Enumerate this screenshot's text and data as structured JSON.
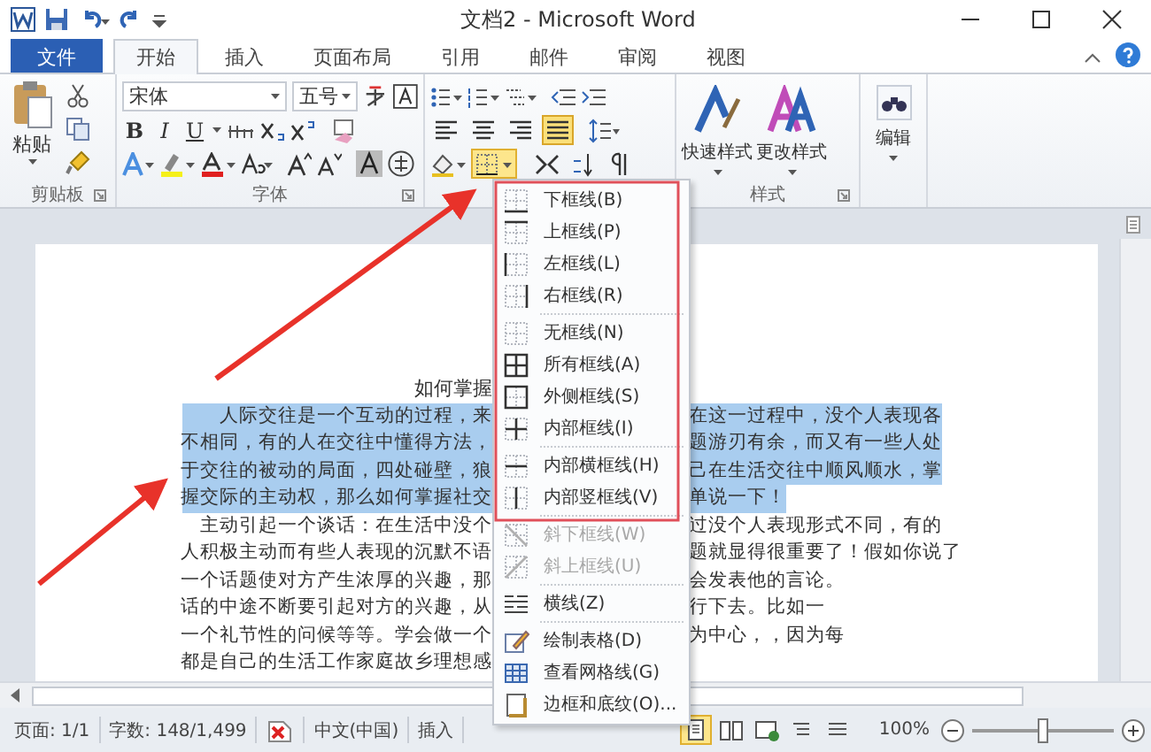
{
  "window": {
    "title": "文档2 - Microsoft Word"
  },
  "tabs": [
    {
      "label": "文件",
      "kind": "file",
      "selected": false
    },
    {
      "label": "开始",
      "kind": "tab",
      "selected": true
    },
    {
      "label": "插入",
      "kind": "tab",
      "selected": false
    },
    {
      "label": "页面布局",
      "kind": "tab",
      "selected": false
    },
    {
      "label": "引用",
      "kind": "tab",
      "selected": false
    },
    {
      "label": "邮件",
      "kind": "tab",
      "selected": false
    },
    {
      "label": "审阅",
      "kind": "tab",
      "selected": false
    },
    {
      "label": "视图",
      "kind": "tab",
      "selected": false
    }
  ],
  "ribbon": {
    "clipboard": {
      "paste": "粘贴",
      "label": "剪贴板"
    },
    "font": {
      "name": "宋体",
      "size": "五号",
      "format_buttons": [
        "B",
        "I",
        "U"
      ],
      "label": "字体"
    },
    "paragraph": {
      "align_buttons": [
        {
          "kind": "left",
          "selected": false
        },
        {
          "kind": "center",
          "selected": false
        },
        {
          "kind": "right",
          "selected": false
        },
        {
          "kind": "justify",
          "selected": true
        }
      ]
    },
    "styles": {
      "buttons": [
        "快速样式",
        "更改样式"
      ],
      "label": "样式"
    },
    "editing": {
      "label": "编辑"
    }
  },
  "document": {
    "title": "如何掌握",
    "lines": [
      {
        "left": "人际交往是一个互动的过程，来",
        "right": "在这一过程中，没个人表现各",
        "selected": true
      },
      {
        "left": "不相同，有的人在交往中懂得方法，",
        "right": "题游刃有余，而又有一些人处",
        "selected": true
      },
      {
        "left": "于交往的被动的局面，四处碰壁，狼",
        "right": "己在生活交往中顺风顺水，掌",
        "selected": true
      },
      {
        "left": "握交际的主动权，那么如何掌握社交",
        "right": "单说一下！",
        "selected": true
      },
      {
        "left": "主动引起一个谈话：在生活中没个",
        "right": "过没个人表现形式不同，有的",
        "selected": false
      },
      {
        "left": "人积极主动而有些人表现的沉默不语",
        "right": "题就显得很重要了！假如你说了",
        "selected": false
      },
      {
        "left": "一个话题使对方产生浓厚的兴趣，那",
        "right": "会发表他的言论。",
        "selected": false
      },
      {
        "left": "话的中途不断要引起对方的兴趣，从",
        "right": "行下去。比如一",
        "selected": false
      },
      {
        "left": "一个礼节性的问候等等。学会做一个",
        "right": "为中心，，因为每",
        "selected": false
      },
      {
        "left": "都是自己的生活工作家庭故乡理想感",
        "selected": false
      }
    ]
  },
  "border_menu": {
    "expanded": true,
    "sections": [
      {
        "items": [
          {
            "label": "下框线(B)",
            "kind": "bottom",
            "disabled": false
          },
          {
            "label": "上框线(P)",
            "kind": "top",
            "disabled": false
          },
          {
            "label": "左框线(L)",
            "kind": "left",
            "disabled": false
          },
          {
            "label": "右框线(R)",
            "kind": "right",
            "disabled": false
          }
        ]
      },
      {
        "items": [
          {
            "label": "无框线(N)",
            "kind": "none",
            "disabled": false
          },
          {
            "label": "所有框线(A)",
            "kind": "all",
            "disabled": false
          },
          {
            "label": "外侧框线(S)",
            "kind": "outside",
            "disabled": false
          },
          {
            "label": "内部框线(I)",
            "kind": "inside",
            "disabled": false
          }
        ]
      },
      {
        "items": [
          {
            "label": "内部横框线(H)",
            "kind": "inside-h",
            "disabled": false
          },
          {
            "label": "内部竖框线(V)",
            "kind": "inside-v",
            "disabled": false
          }
        ]
      },
      {
        "items": [
          {
            "label": "斜下框线(W)",
            "kind": "diag-down",
            "disabled": true
          },
          {
            "label": "斜上框线(U)",
            "kind": "diag-up",
            "disabled": true
          }
        ]
      },
      {
        "items": [
          {
            "label": "横线(Z)",
            "kind": "hline",
            "disabled": false
          }
        ]
      },
      {
        "items": [
          {
            "label": "绘制表格(D)",
            "kind": "draw",
            "disabled": false
          },
          {
            "label": "查看网格线(G)",
            "kind": "grid",
            "disabled": false
          },
          {
            "label": "边框和底纹(O)...",
            "kind": "shading",
            "disabled": false
          }
        ]
      }
    ]
  },
  "status_bar": {
    "page": "页面: 1/1",
    "words": "字数: 148/1,499",
    "language": "中文(中国)",
    "mode": "插入",
    "views": [
      {
        "kind": "print",
        "selected": true
      },
      {
        "kind": "reading",
        "selected": false
      },
      {
        "kind": "web",
        "selected": false
      },
      {
        "kind": "outline",
        "selected": false
      },
      {
        "kind": "draft",
        "selected": false
      }
    ],
    "zoom": "100%",
    "zoom_slider": {
      "level": 0.5
    }
  }
}
